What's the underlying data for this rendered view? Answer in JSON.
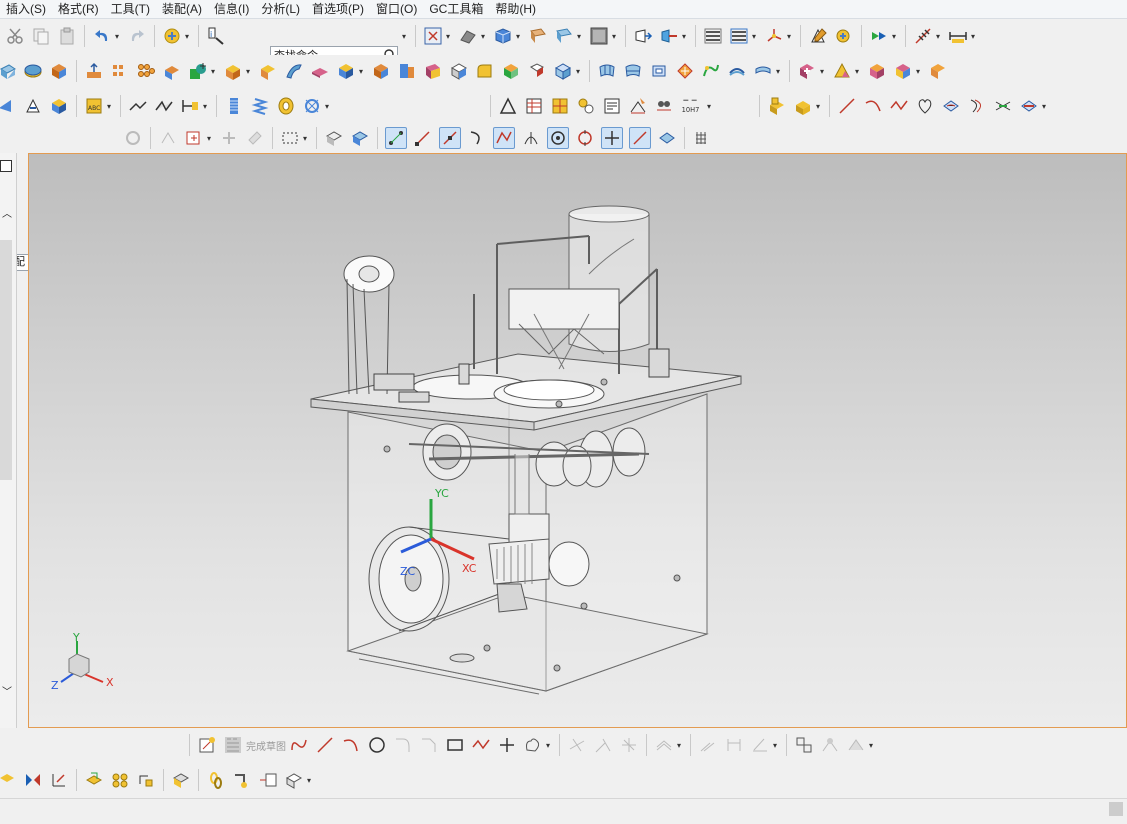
{
  "menu": [
    "插入(S)",
    "格式(R)",
    "工具(T)",
    "装配(A)",
    "信息(I)",
    "分析(L)",
    "首选项(P)",
    "窗口(O)",
    "GC工具箱",
    "帮助(H)"
  ],
  "search": {
    "placeholder": "查找命令"
  },
  "assembly_filter": {
    "value": "装配"
  },
  "tolerance_label": "10H7",
  "sketch_toolbar": {
    "finish_label": "完成草图"
  },
  "viewport": {
    "csys_labels": {
      "yc": "YC",
      "xc": "XC",
      "zc": "ZC"
    },
    "triad_labels": {
      "x": "X",
      "y": "Y",
      "z": "Z"
    }
  },
  "colors": {
    "accent_border": "#e39b51",
    "x_axis": "#d9342b",
    "y_axis": "#2aa640",
    "z_axis": "#2b5bd9"
  }
}
